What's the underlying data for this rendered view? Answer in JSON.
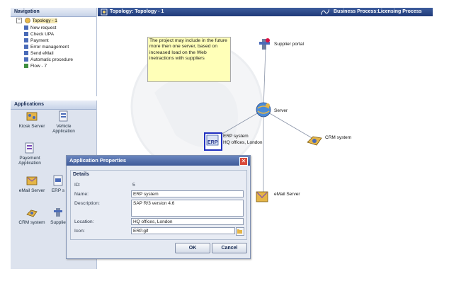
{
  "navigation": {
    "title": "Navigation",
    "root": "Topology - 1",
    "items": [
      "New request",
      "Check UPA",
      "Payment",
      "Error management",
      "Send eMail",
      "Automatic procedure",
      "Flow - 7"
    ]
  },
  "applications": {
    "title": "Applications",
    "tiles": [
      {
        "label": "Kiosk Server",
        "icon": "kiosk-server-icon"
      },
      {
        "label": "Vehicle Application",
        "icon": "vehicle-app-icon"
      },
      {
        "label": "Payement Application",
        "icon": "payment-app-icon"
      },
      {
        "label": "eMail Server",
        "icon": "email-server-icon"
      },
      {
        "label": "ERP s",
        "icon": "erp-icon"
      },
      {
        "label": "CRM system",
        "icon": "crm-icon"
      },
      {
        "label": "Supplie",
        "icon": "supplier-icon"
      }
    ]
  },
  "canvas": {
    "title": "Topology: Topology - 1",
    "tab_right": "Business Process:Licensing Process",
    "note": "The project may include in the future more then one server, based on increased load on the Web inetractions with suppliers",
    "nodes": {
      "supplier": "Supplier portal",
      "server": "Server",
      "erp_line1": "ERP system",
      "erp_line2": "HQ offices, London",
      "crm": "CRM system",
      "email": "eMail Server"
    }
  },
  "dialog": {
    "title": "Application Properties",
    "group": "Details",
    "id_label": "ID:",
    "id_value": "5",
    "name_label": "Name:",
    "name_value": "ERP system",
    "desc_label": "Description:",
    "desc_value": "SAP R/3 version 4.6",
    "location_label": "Location:",
    "location_value": "HQ offices, London",
    "icon_label": "Icon:",
    "icon_value": "ERP.gif",
    "ok": "OK",
    "cancel": "Cancel",
    "close": "✕"
  }
}
